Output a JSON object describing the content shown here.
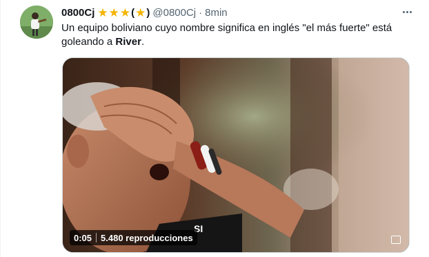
{
  "author": {
    "display_name": "0800Cj",
    "handle": "@0800Cj",
    "separator": "·",
    "time": "8min",
    "paren_open": "(",
    "paren_close": ")"
  },
  "tweet": {
    "text_before": "Un equipo boliviano cuyo nombre significa en inglés \"el más fuerte\" está goleando a ",
    "mention": "River",
    "text_after": "."
  },
  "media": {
    "duration": "0:05",
    "views": "5.480 reproducciones",
    "shirt_text": "SI"
  },
  "colors": {
    "star": "#f4b400",
    "secondary_text": "#536471",
    "badge_bg": "#000000"
  }
}
